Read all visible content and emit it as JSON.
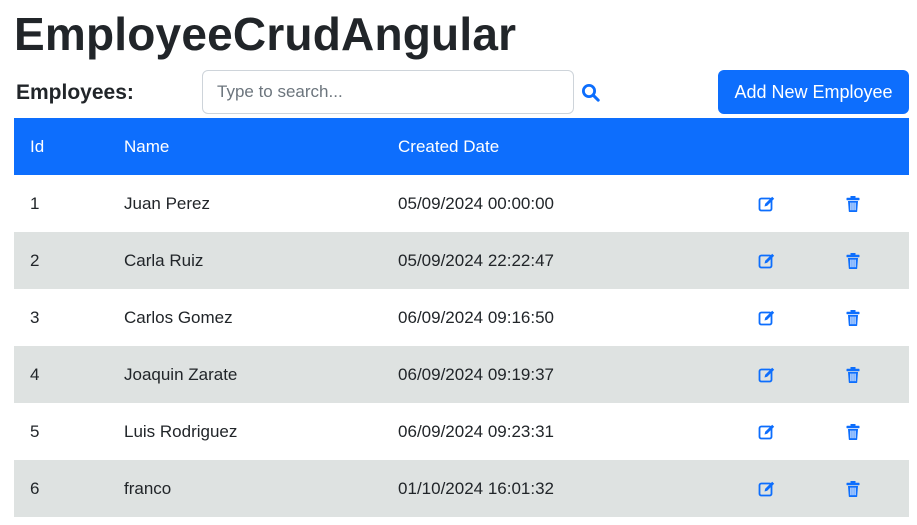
{
  "app": {
    "title": "EmployeeCrudAngular"
  },
  "toolbar": {
    "label": "Employees:",
    "search_placeholder": "Type to search...",
    "search_value": "",
    "search_icon": "search-icon",
    "add_button_label": "Add New Employee"
  },
  "table": {
    "headers": {
      "id": "Id",
      "name": "Name",
      "created": "Created Date"
    },
    "rows": [
      {
        "id": "1",
        "name": "Juan Perez",
        "created": "05/09/2024 00:00:00"
      },
      {
        "id": "2",
        "name": "Carla Ruiz",
        "created": "05/09/2024 22:22:47"
      },
      {
        "id": "3",
        "name": "Carlos Gomez",
        "created": "06/09/2024 09:16:50"
      },
      {
        "id": "4",
        "name": "Joaquin Zarate",
        "created": "06/09/2024 09:19:37"
      },
      {
        "id": "5",
        "name": "Luis Rodriguez",
        "created": "06/09/2024 09:23:31"
      },
      {
        "id": "6",
        "name": "franco",
        "created": "01/10/2024 16:01:32"
      }
    ],
    "row_icons": {
      "edit": "edit-icon",
      "delete": "trash-icon"
    }
  },
  "colors": {
    "primary": "#0d6efd",
    "stripe": "#dee2e1",
    "text": "#212529"
  }
}
